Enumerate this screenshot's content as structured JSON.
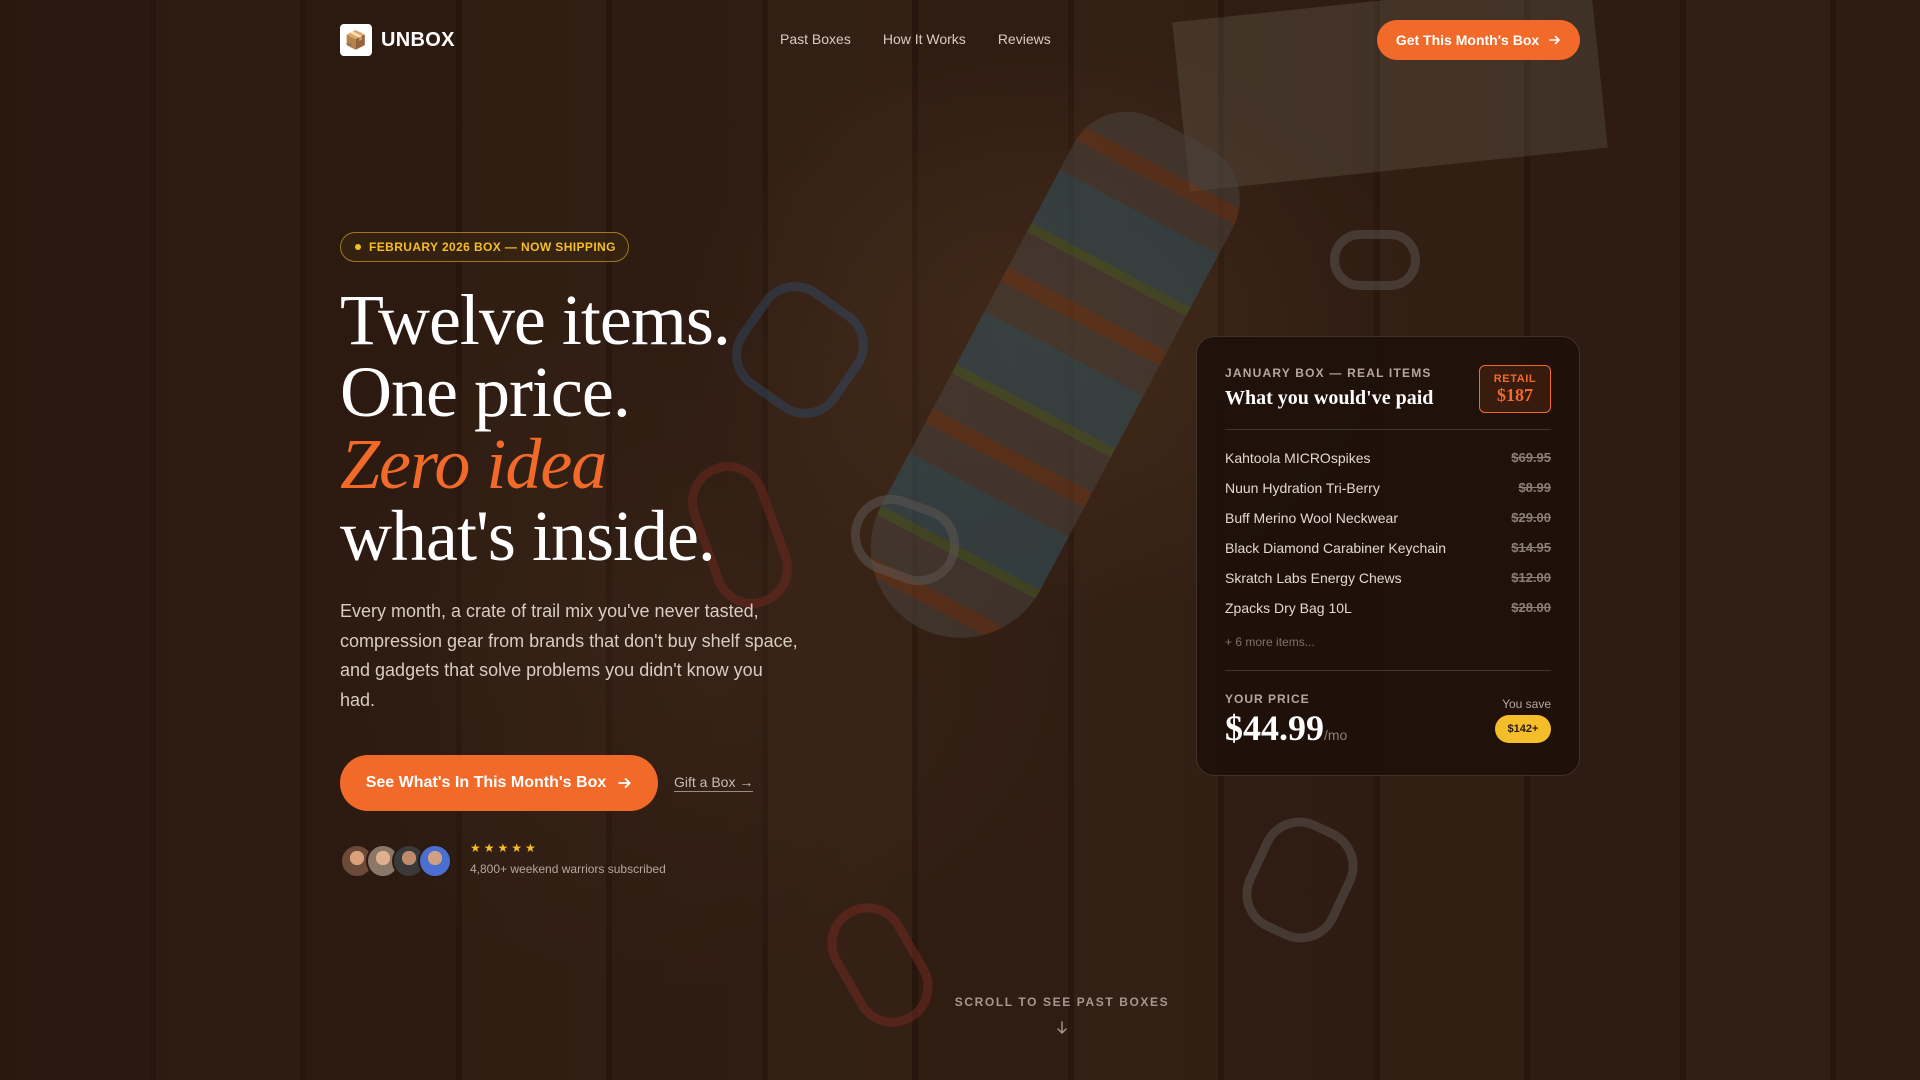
{
  "brand": {
    "name": "UNBOX",
    "logo_icon": "box-logo-icon"
  },
  "nav": {
    "links": [
      "Past Boxes",
      "How It Works",
      "Reviews"
    ],
    "cta_label": "Get This Month's Box"
  },
  "hero": {
    "badge": "FEBRUARY 2026 BOX — NOW SHIPPING",
    "headline": [
      "Twelve items.",
      "One price.",
      "Zero idea",
      "what's inside."
    ],
    "description": "Every month, a crate of trail mix you've never tasted, compression gear from brands that don't buy shelf space, and gadgets that solve problems you didn't know you had.",
    "primary_cta": "See What's In This Month's Box",
    "secondary_cta": "Gift a Box →",
    "rating_stars": "★★★★★",
    "subscribers_text": "4,800+ weekend warriors subscribed"
  },
  "card": {
    "eyebrow": "JANUARY BOX — REAL ITEMS",
    "title": "What you would've paid",
    "retail_label": "RETAIL",
    "retail_value": "$187",
    "items": [
      {
        "name": "Kahtoola MICROspikes",
        "price": "$69.95"
      },
      {
        "name": "Nuun Hydration Tri-Berry",
        "price": "$8.99"
      },
      {
        "name": "Buff Merino Wool Neckwear",
        "price": "$29.00"
      },
      {
        "name": "Black Diamond Carabiner Keychain",
        "price": "$14.95"
      },
      {
        "name": "Skratch Labs Energy Chews",
        "price": "$12.00"
      },
      {
        "name": "Zpacks Dry Bag 10L",
        "price": "$28.00"
      }
    ],
    "more_items": "+ 6 more items...",
    "your_price_label": "YOUR PRICE",
    "your_price": "$44.99",
    "per": "/mo",
    "you_save_label": "You save",
    "you_save_value": "$142+"
  },
  "scroll_hint": "SCROLL TO SEE PAST BOXES",
  "colors": {
    "accent": "#f26a2a",
    "gold": "#f4be2a",
    "background": "#2a1a11"
  }
}
